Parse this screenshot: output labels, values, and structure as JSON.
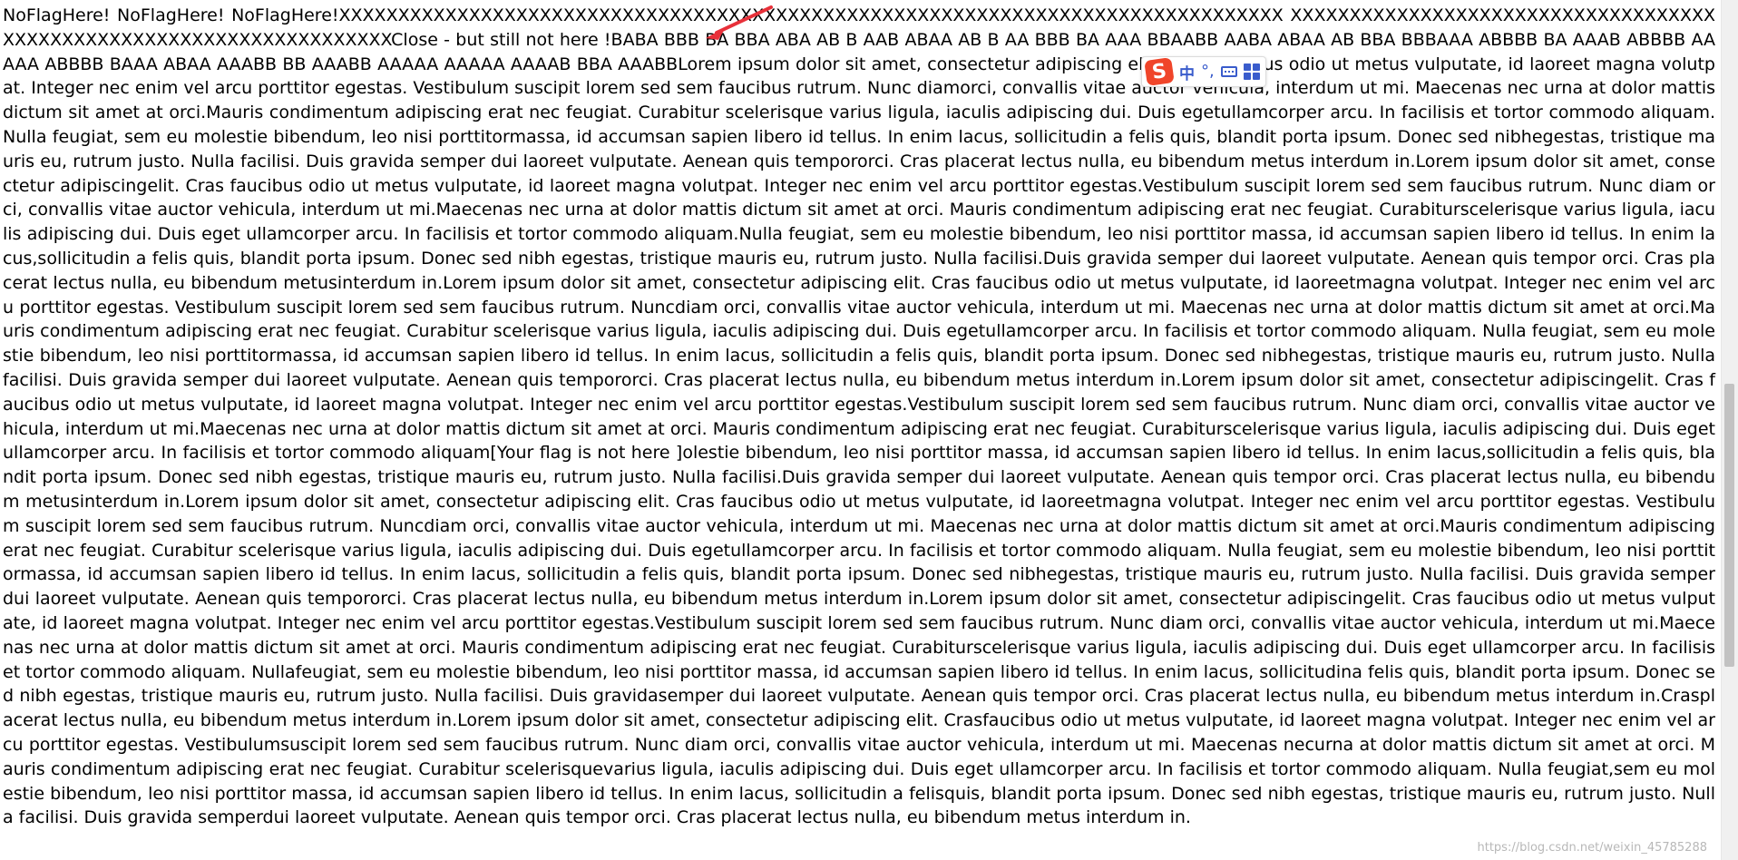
{
  "document": {
    "text": "NoFlagHere! NoFlagHere! NoFlagHere!XXXXXXXXXXXXXXXXXXXXXXXXXXXXXXXXXXXXXXXXXXXXXXXXXXXXXXXXXXXXXXXXXXXXXXXXXXXXXXXX XXXXXXXXXXXXXXXXXXXXXXXXXXXXXXXXXXXXXXXXXXXXXXXXXXXXXXXXXXXXXXXXXXXXXClose - but still not here !BABA BBB BA BBA ABA AB B AAB ABAA AB B AA BBB BA AAA BBAABB AABA ABAA AB BBA BBBAAA ABBBB BA AAAB ABBBB AAAAA ABBBB BAAA ABAA AAABB BB AAABB AAAAA AAAAA AAAAB BBA AAABBLorem ipsum dolor sit amet,  consectetur adipiscing elit.  Cras faucibus odio ut metus vulputate,  id laoreet magna volutpat. Integer nec enim vel arcu porttitor egestas. Vestibulum suscipit lorem sed sem faucibus rutrum.  Nunc diamorci,  convallis vitae auctor vehicula,  interdum ut mi.  Maecenas nec urna at dolor mattis dictum sit amet at orci.Mauris condimentum adipiscing erat nec feugiat.  Curabitur scelerisque varius ligula,  iaculis adipiscing dui.  Duis egetullamcorper arcu.  In facilisis et tortor commodo aliquam.  Nulla feugiat, sem eu molestie bibendum, leo nisi porttitormassa, id accumsan sapien libero id tellus.  In enim lacus, sollicitudin a felis quis, blandit porta ipsum.  Donec sed nibhegestas, tristique mauris eu, rutrum justo.  Nulla facilisi.  Duis gravida semper dui laoreet vulputate.  Aenean quis tempororci.  Cras placerat lectus nulla,  eu bibendum metus interdum in.Lorem ipsum dolor sit amet, consectetur adipiscingelit.  Cras faucibus odio ut metus vulputate, id laoreet magna volutpat.  Integer nec enim vel arcu porttitor egestas.Vestibulum suscipit lorem sed sem faucibus rutrum.  Nunc diam orci,  convallis vitae auctor vehicula,  interdum ut mi.Maecenas nec urna at dolor mattis dictum sit amet at orci.  Mauris condimentum adipiscing erat nec feugiat.  Curabiturscelerisque  varius ligula,  iaculis adipiscing dui.  Duis eget ullamcorper arcu.  In facilisis et tortor commodo aliquam.Nulla feugiat, sem eu molestie bibendum, leo nisi porttitor massa, id accumsan sapien libero id tellus.  In enim lacus,sollicitudin a felis quis, blandit porta ipsum.  Donec sed nibh egestas, tristique mauris eu, rutrum justo.  Nulla facilisi.Duis gravida semper dui laoreet vulputate.  Aenean quis tempor orci.  Cras placerat lectus nulla,  eu bibendum metusinterdum in.Lorem ipsum dolor sit amet, consectetur adipiscing elit.  Cras faucibus odio ut metus vulputate, id laoreetmagna volutpat. Integer nec enim vel arcu porttitor egestas.  Vestibulum suscipit lorem sed sem faucibus rutrum.  Nuncdiam orci, convallis vitae auctor vehicula, interdum ut mi.  Maecenas nec urna at dolor mattis dictum sit amet at orci.Mauris condimentum adipiscing erat nec feugiat.  Curabitur scelerisque varius ligula,  iaculis adipiscing dui.  Duis egetullamcorper arcu.  In facilisis et tortor commodo aliquam.  Nulla feugiat, sem eu molestie bibendum, leo nisi porttitormassa, id accumsan sapien libero id tellus.  In enim lacus, sollicitudin a felis quis, blandit porta ipsum.  Donec sed nibhegestas, tristique mauris eu, rutrum justo.  Nulla facilisi.  Duis gravida semper dui laoreet vulputate.  Aenean quis tempororci.  Cras placerat lectus nulla,  eu bibendum metus interdum in.Lorem ipsum dolor sit amet,  consectetur adipiscingelit.  Cras faucibus odio ut metus vulputate,  id laoreet magna volutpat.  Integer nec enim vel arcu porttitor egestas.Vestibulum suscipit lorem sed sem faucibus rutrum.  Nunc diam orci,  convallis vitae auctor vehicula,  interdum ut mi.Maecenas nec urna at dolor mattis dictum sit amet at orci.  Mauris condimentum adipiscing erat nec feugiat.  Curabiturscelerisque varius ligula, iaculis adipiscing dui.  Duis eget ullamcorper arcu.  In facilisis et tortor commodo aliquam[Your flag is not here ]olestie bibendum, leo nisi porttitor massa, id accumsan sapien libero id tellus.  In enim lacus,sollicitudin a felis quis, blandit porta ipsum.  Donec sed nibh egestas, tristique mauris eu, rutrum justo.  Nulla facilisi.Duis gravida semper dui laoreet vulputate.  Aenean quis tempor orci.  Cras placerat lectus nulla,  eu bibendum metusinterdum in.Lorem ipsum dolor sit amet, consectetur adipiscing elit.  Cras faucibus odio ut metus vulputate, id laoreetmagna volutpat.  Integer nec enim vel arcu porttitor egestas.  Vestibulum suscipit lorem sed sem faucibus rutrum.  Nuncdiam orci, convallis vitae auctor vehicula, interdum ut mi.  Maecenas nec urna at dolor mattis dictum sit amet at orci.Mauris condimentum adipiscing erat nec feugiat.  Curabitur scelerisque varius ligula,  iaculis adipiscing dui.  Duis egetullamcorper arcu.  In facilisis et tortor commodo aliquam.  Nulla feugiat, sem eu molestie bibendum, leo nisi porttitormassa, id accumsan sapien libero id tellus.  In enim lacus, sollicitudin a felis quis, blandit porta ipsum.  Donec sed nibhegestas, tristique mauris eu, rutrum justo.  Nulla facilisi.  Duis gravida semper dui laoreet vulputate.  Aenean quis tempororci.  Cras placerat lectus nulla,  eu bibendum metus interdum in.Lorem ipsum dolor sit amet, consectetur adipiscingelit.  Cras faucibus odio ut metus vulputate, id laoreet magna volutpat.  Integer nec enim vel arcu porttitor egestas.Vestibulum suscipit lorem sed sem faucibus rutrum.  Nunc diam orci,  convallis vitae auctor vehicula,  interdum ut mi.Maecenas nec urna at dolor mattis dictum sit amet at orci.  Mauris condimentum adipiscing erat nec feugiat.  Curabiturscelerisque varius ligula, iaculis adipiscing dui.  Duis eget ullamcorper arcu.  In facilisis et tortor commodo aliquam.  Nullafeugiat, sem eu molestie bibendum, leo nisi porttitor massa, id accumsan sapien libero id tellus.  In enim lacus, sollicitudina felis quis, blandit porta ipsum.  Donec sed nibh egestas, tristique mauris eu, rutrum justo.  Nulla facilisi.  Duis gravidasemper dui laoreet vulputate.  Aenean quis tempor orci.  Cras placerat lectus nulla, eu bibendum metus interdum in.Crasplacerat lectus nulla, eu bibendum metus interdum in.Lorem ipsum dolor sit amet, consectetur adipiscing elit.  Crasfaucibus odio ut metus vulputate, id laoreet magna volutpat.  Integer nec enim vel arcu porttitor egestas.  Vestibulumsuscipit lorem sed sem faucibus rutrum.  Nunc diam orci, convallis vitae auctor vehicula, interdum ut mi.  Maecenas necurna at dolor mattis dictum sit amet at orci.  Mauris condimentum adipiscing erat nec feugiat.  Curabitur scelerisquevarius ligula, iaculis adipiscing dui.  Duis eget ullamcorper arcu.  In facilisis et tortor commodo aliquam.  Nulla feugiat,sem eu molestie bibendum, leo nisi porttitor massa, id accumsan sapien libero id tellus.  In enim lacus, sollicitudin a felisquis, blandit porta ipsum.  Donec sed nibh egestas, tristique mauris eu, rutrum justo.  Nulla facilisi.  Duis gravida semperdui laoreet vulputate.  Aenean quis tempor orci.  Cras placerat lectus nulla, eu bibendum metus interdum in."
  },
  "ime_toolbar": {
    "logo": "S",
    "mode": "中",
    "punctuation": "°,",
    "logo_color": "#f0452a",
    "icon_color": "#3a5ccc"
  },
  "scrollbar": {
    "position_fraction": 0.67
  },
  "annotation": {
    "color": "#e8313a"
  },
  "watermark": {
    "text": "https://blog.csdn.net/weixin_45785288"
  },
  "colors": {
    "background": "#ffffff",
    "text": "#000000"
  }
}
